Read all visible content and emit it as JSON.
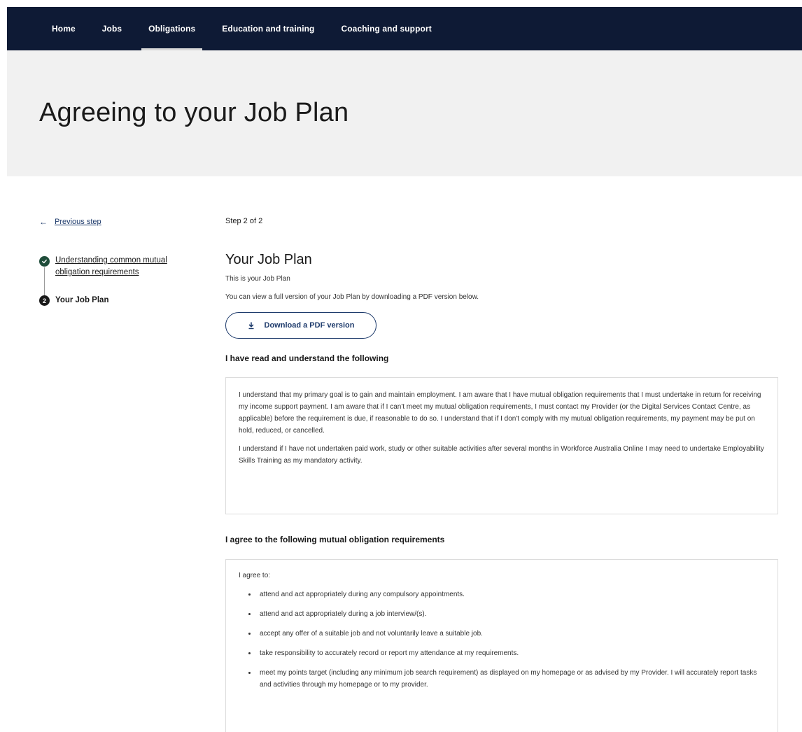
{
  "nav": {
    "items": [
      {
        "label": "Home",
        "active": false
      },
      {
        "label": "Jobs",
        "active": false
      },
      {
        "label": "Obligations",
        "active": true
      },
      {
        "label": "Education and training",
        "active": false
      },
      {
        "label": "Coaching and support",
        "active": false
      }
    ]
  },
  "hero": {
    "title": "Agreeing to your Job Plan"
  },
  "sidebar": {
    "prev_link": "Previous step",
    "steps": [
      {
        "number": "",
        "status": "complete",
        "label": "Understanding common mutual obligation requirements"
      },
      {
        "number": "2",
        "status": "current",
        "label": "Your Job Plan"
      }
    ]
  },
  "main": {
    "step_count": "Step 2 of 2",
    "title": "Your Job Plan",
    "intro": "This is your Job Plan",
    "intro2": "You can view a full version of your Job Plan by downloading a PDF version below.",
    "download_label": "Download a PDF version",
    "read_heading": "I have read and understand the following",
    "read_paragraphs": [
      "I understand that my primary goal is to gain and maintain employment. I am aware that I have mutual obligation requirements that I must undertake in return for receiving my income support payment. I am aware that if I can't meet my mutual obligation requirements, I must contact my Provider (or the Digital Services Contact Centre, as applicable) before the requirement is due, if reasonable to do so. I understand that if I don't comply with my mutual obligation requirements, my payment may be put on hold, reduced, or cancelled.",
      "I understand if I have not undertaken paid work, study or other suitable activities after several months in Workforce Australia Online I may need to undertake Employability Skills Training as my mandatory activity."
    ],
    "agree_heading": "I agree to the following mutual obligation requirements",
    "agree_lead": "I agree to:",
    "agree_items": [
      "attend and act appropriately during any compulsory appointments.",
      "attend and act appropriately during a job interview/(s).",
      "accept any offer of a suitable job and not voluntarily leave a suitable job.",
      "take responsibility to accurately record or report my attendance at my requirements.",
      "meet my points target (including any minimum job search requirement) as displayed on my homepage or as advised by my Provider. I will accurately report tasks and activities through my homepage or to my provider."
    ]
  },
  "colors": {
    "nav_bg": "#0e1a35",
    "hero_bg": "#f1f1f1",
    "link": "#1d3a6b",
    "complete": "#1f4d3a"
  }
}
